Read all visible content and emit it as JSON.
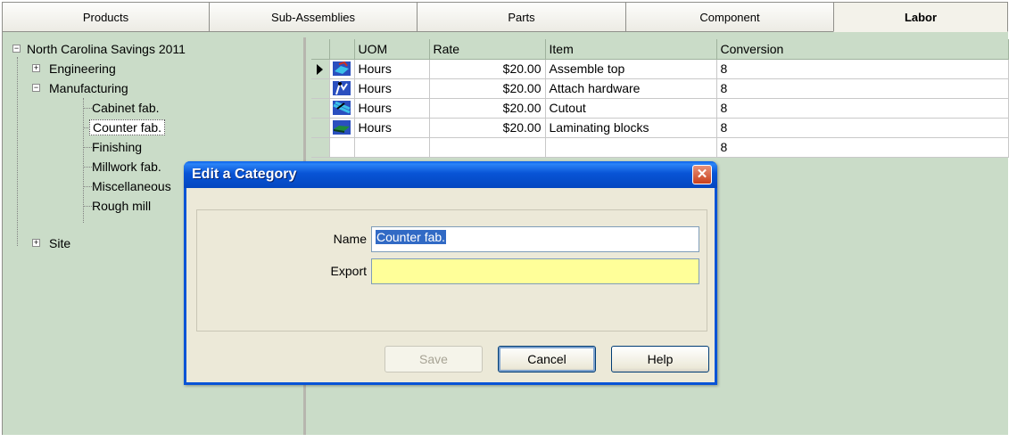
{
  "tabs": [
    {
      "label": "Products"
    },
    {
      "label": "Sub-Assemblies"
    },
    {
      "label": "Parts"
    },
    {
      "label": "Component"
    },
    {
      "label": "Labor",
      "active": true
    }
  ],
  "tree": {
    "root": "North Carolina Savings 2011",
    "nodes": [
      {
        "label": "Engineering"
      },
      {
        "label": "Manufacturing"
      },
      {
        "label": "Site"
      }
    ],
    "manufacturing_children": [
      "Cabinet fab.",
      "Counter fab.",
      "Finishing",
      "Millwork fab.",
      "Miscellaneous",
      "Rough mill"
    ],
    "selected": "Counter fab."
  },
  "grid": {
    "headers": [
      "UOM",
      "Rate",
      "Item",
      "Conversion"
    ],
    "rows": [
      {
        "uom": "Hours",
        "rate": "$20.00",
        "item": "Assemble top",
        "conversion": "8",
        "icon": "assemble-icon"
      },
      {
        "uom": "Hours",
        "rate": "$20.00",
        "item": "Attach hardware",
        "conversion": "8",
        "icon": "hardware-icon"
      },
      {
        "uom": "Hours",
        "rate": "$20.00",
        "item": "Cutout",
        "conversion": "8",
        "icon": "cutout-icon"
      },
      {
        "uom": "Hours",
        "rate": "$20.00",
        "item": "Laminating blocks",
        "conversion": "8",
        "icon": "laminate-icon"
      },
      {
        "uom": "",
        "rate": "",
        "item": "",
        "conversion": "8",
        "icon": ""
      }
    ]
  },
  "dialog": {
    "title": "Edit a Category",
    "name_label": "Name",
    "name_value": "Counter fab.",
    "export_label": "Export",
    "export_value": "",
    "save_label": "Save",
    "cancel_label": "Cancel",
    "help_label": "Help"
  },
  "colors": {
    "panel_bg": "#cadcc8",
    "dialog_bg": "#ece9d8",
    "titlebar": "#0854d6",
    "export_field": "#ffff99"
  }
}
